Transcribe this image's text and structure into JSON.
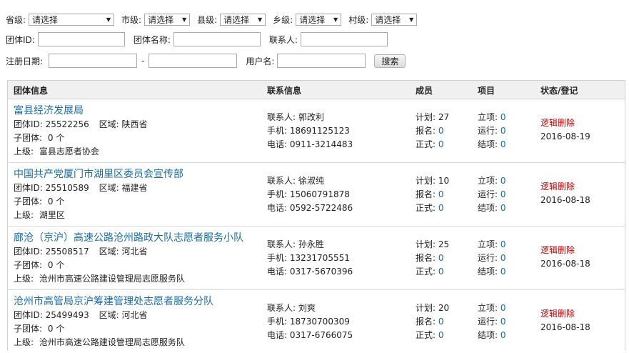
{
  "filters": {
    "province": {
      "label": "省级:",
      "value": "请选择"
    },
    "city": {
      "label": "市级:",
      "value": "请选择"
    },
    "county": {
      "label": "县级:",
      "value": "请选择"
    },
    "township": {
      "label": "乡级:",
      "value": "请选择"
    },
    "village": {
      "label": "村级:",
      "value": "请选择"
    },
    "group_id_label": "团体ID:",
    "group_name_label": "团体名称:",
    "contact_label": "联系人:",
    "reg_date_label": "注册日期:",
    "date_sep": "-",
    "username_label": "用户名:",
    "search_button": "搜索"
  },
  "table": {
    "headers": [
      "团体信息",
      "联系信息",
      "成员",
      "项目",
      "状态/登记"
    ],
    "labels": {
      "id": "团体ID:",
      "region": "区域:",
      "sub": "子团体:",
      "parent": "上级:",
      "contact": "联系人:",
      "phone": "手机:",
      "tel": "电话:",
      "plan": "计划:",
      "signup": "报名:",
      "formal": "正式:",
      "setup": "立项:",
      "running": "运行:",
      "closed": "结项:"
    },
    "rows": [
      {
        "name": "富县经济发展局",
        "id": "25522256",
        "region": "陕西省",
        "sub": "0 个",
        "parent": "富县志愿者协会",
        "contact": "郭改利",
        "phone": "18691125123",
        "tel": "0911-3214483",
        "plan": "27",
        "signup": "0",
        "formal": "0",
        "setup": "0",
        "running": "0",
        "closed": "0",
        "status": "逻辑删除",
        "date": "2016-08-19"
      },
      {
        "name": "中国共产党厦门市湖里区委员会宣传部",
        "id": "25510589",
        "region": "福建省",
        "sub": "0 个",
        "parent": "湖里区",
        "contact": "徐淑纯",
        "phone": "15060791878",
        "tel": "0592-5722486",
        "plan": "10",
        "signup": "0",
        "formal": "0",
        "setup": "0",
        "running": "0",
        "closed": "0",
        "status": "逻辑删除",
        "date": "2016-08-18"
      },
      {
        "name": "廊沧（京沪）高速公路沧州路政大队志愿者服务小队",
        "id": "25508517",
        "region": "河北省",
        "sub": "0 个",
        "parent": "沧州市高速公路建设管理局志愿服务队",
        "contact": "孙永胜",
        "phone": "13231705551",
        "tel": "0317-5670396",
        "plan": "25",
        "signup": "0",
        "formal": "0",
        "setup": "0",
        "running": "0",
        "closed": "0",
        "status": "逻辑删除",
        "date": "2016-08-18"
      },
      {
        "name": "沧州市高管局京沪筹建管理处志愿者服务分队",
        "id": "25499493",
        "region": "河北省",
        "sub": "0 个",
        "parent": "沧州市高速公路建设管理局志愿服务队",
        "contact": "刘爽",
        "phone": "18730700309",
        "tel": "0317-6766075",
        "plan": "20",
        "signup": "0",
        "formal": "0",
        "setup": "0",
        "running": "0",
        "closed": "0",
        "status": "逻辑删除",
        "date": "2016-08-18"
      }
    ]
  }
}
